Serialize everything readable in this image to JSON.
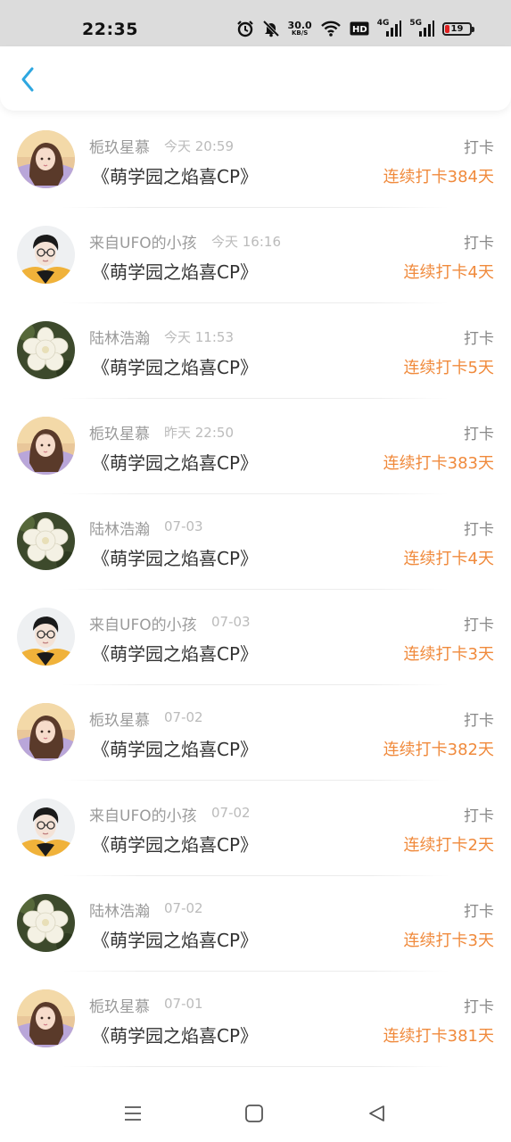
{
  "status_bar": {
    "time": "22:35",
    "net_speed_value": "30.0",
    "net_speed_unit": "KB/S",
    "hd_label": "HD",
    "sig1_label": "4G",
    "sig2_label": "5G",
    "battery_level": "19"
  },
  "colors": {
    "accent_blue": "#2ea7e0",
    "streak_orange": "#f08a3c",
    "battery_low": "#e02020"
  },
  "list": [
    {
      "user": "栀玖星慕",
      "time": "今天 20:59",
      "title": "《萌学园之焰喜CP》",
      "action": "打卡",
      "streak": "连续打卡384天",
      "avatar": "girl"
    },
    {
      "user": "来自UFO的小孩",
      "time": "今天 16:16",
      "title": "《萌学园之焰喜CP》",
      "action": "打卡",
      "streak": "连续打卡4天",
      "avatar": "boy"
    },
    {
      "user": "陆林浩瀚",
      "time": "今天 11:53",
      "title": "《萌学园之焰喜CP》",
      "action": "打卡",
      "streak": "连续打卡5天",
      "avatar": "flower"
    },
    {
      "user": "栀玖星慕",
      "time": "昨天 22:50",
      "title": "《萌学园之焰喜CP》",
      "action": "打卡",
      "streak": "连续打卡383天",
      "avatar": "girl"
    },
    {
      "user": "陆林浩瀚",
      "time": "07-03",
      "title": "《萌学园之焰喜CP》",
      "action": "打卡",
      "streak": "连续打卡4天",
      "avatar": "flower"
    },
    {
      "user": "来自UFO的小孩",
      "time": "07-03",
      "title": "《萌学园之焰喜CP》",
      "action": "打卡",
      "streak": "连续打卡3天",
      "avatar": "boy"
    },
    {
      "user": "栀玖星慕",
      "time": "07-02",
      "title": "《萌学园之焰喜CP》",
      "action": "打卡",
      "streak": "连续打卡382天",
      "avatar": "girl"
    },
    {
      "user": "来自UFO的小孩",
      "time": "07-02",
      "title": "《萌学园之焰喜CP》",
      "action": "打卡",
      "streak": "连续打卡2天",
      "avatar": "boy"
    },
    {
      "user": "陆林浩瀚",
      "time": "07-02",
      "title": "《萌学园之焰喜CP》",
      "action": "打卡",
      "streak": "连续打卡3天",
      "avatar": "flower"
    },
    {
      "user": "栀玖星慕",
      "time": "07-01",
      "title": "《萌学园之焰喜CP》",
      "action": "打卡",
      "streak": "连续打卡381天",
      "avatar": "girl"
    }
  ]
}
